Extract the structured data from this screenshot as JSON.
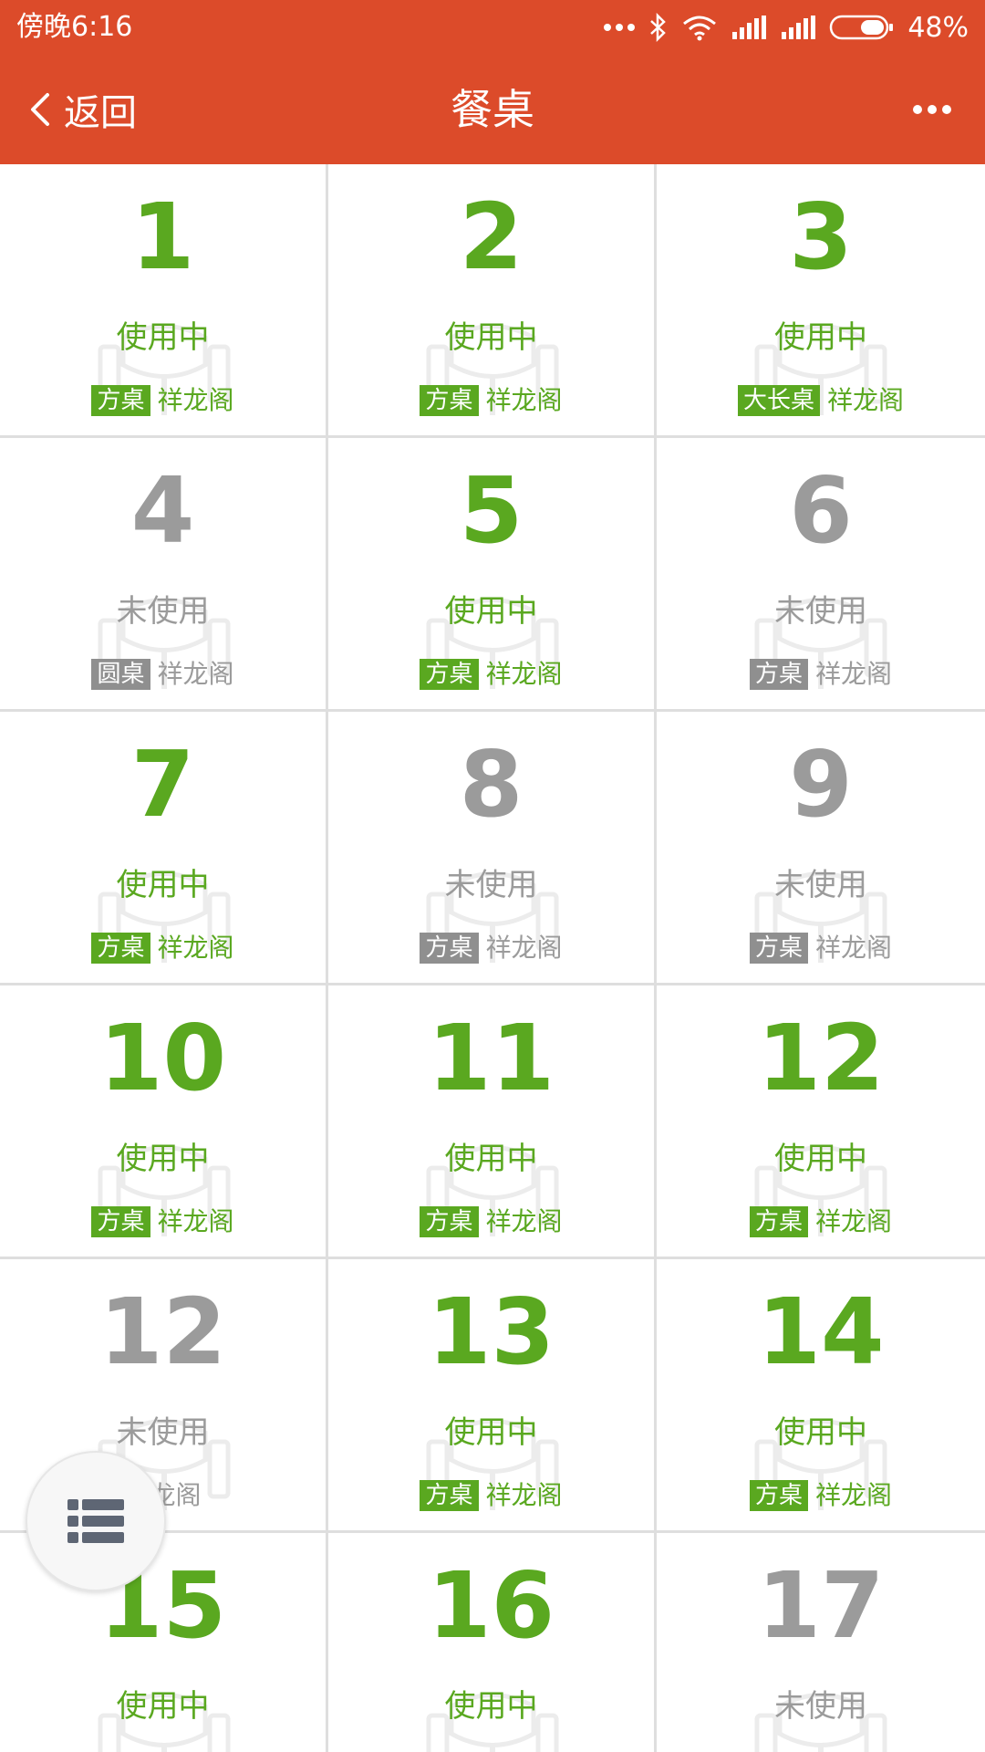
{
  "status_bar": {
    "time": "傍晚6:16",
    "battery": "48%"
  },
  "header": {
    "back_label": "返回",
    "title": "餐桌"
  },
  "tables": [
    {
      "number": "1",
      "status": "使用中",
      "type": "方桌",
      "room": "祥龙阁",
      "state": "active"
    },
    {
      "number": "2",
      "status": "使用中",
      "type": "方桌",
      "room": "祥龙阁",
      "state": "active"
    },
    {
      "number": "3",
      "status": "使用中",
      "type": "大长桌",
      "room": "祥龙阁",
      "state": "active"
    },
    {
      "number": "4",
      "status": "未使用",
      "type": "圆桌",
      "room": "祥龙阁",
      "state": "idle"
    },
    {
      "number": "5",
      "status": "使用中",
      "type": "方桌",
      "room": "祥龙阁",
      "state": "active"
    },
    {
      "number": "6",
      "status": "未使用",
      "type": "方桌",
      "room": "祥龙阁",
      "state": "idle"
    },
    {
      "number": "7",
      "status": "使用中",
      "type": "方桌",
      "room": "祥龙阁",
      "state": "active"
    },
    {
      "number": "8",
      "status": "未使用",
      "type": "方桌",
      "room": "祥龙阁",
      "state": "idle"
    },
    {
      "number": "9",
      "status": "未使用",
      "type": "方桌",
      "room": "祥龙阁",
      "state": "idle"
    },
    {
      "number": "10",
      "status": "使用中",
      "type": "方桌",
      "room": "祥龙阁",
      "state": "active"
    },
    {
      "number": "11",
      "status": "使用中",
      "type": "方桌",
      "room": "祥龙阁",
      "state": "active"
    },
    {
      "number": "12",
      "status": "使用中",
      "type": "方桌",
      "room": "祥龙阁",
      "state": "active"
    },
    {
      "number": "12",
      "status": "未使用",
      "type": "",
      "room": "祥龙阁",
      "state": "idle"
    },
    {
      "number": "13",
      "status": "使用中",
      "type": "方桌",
      "room": "祥龙阁",
      "state": "active"
    },
    {
      "number": "14",
      "status": "使用中",
      "type": "方桌",
      "room": "祥龙阁",
      "state": "active"
    },
    {
      "number": "15",
      "status": "使用中",
      "type": "",
      "room": "",
      "state": "active"
    },
    {
      "number": "16",
      "status": "使用中",
      "type": "",
      "room": "",
      "state": "active"
    },
    {
      "number": "17",
      "status": "未使用",
      "type": "",
      "room": "",
      "state": "idle"
    }
  ],
  "colors": {
    "header": "#dc4b2a",
    "active": "#5aa820",
    "idle": "#9b9b9b"
  }
}
